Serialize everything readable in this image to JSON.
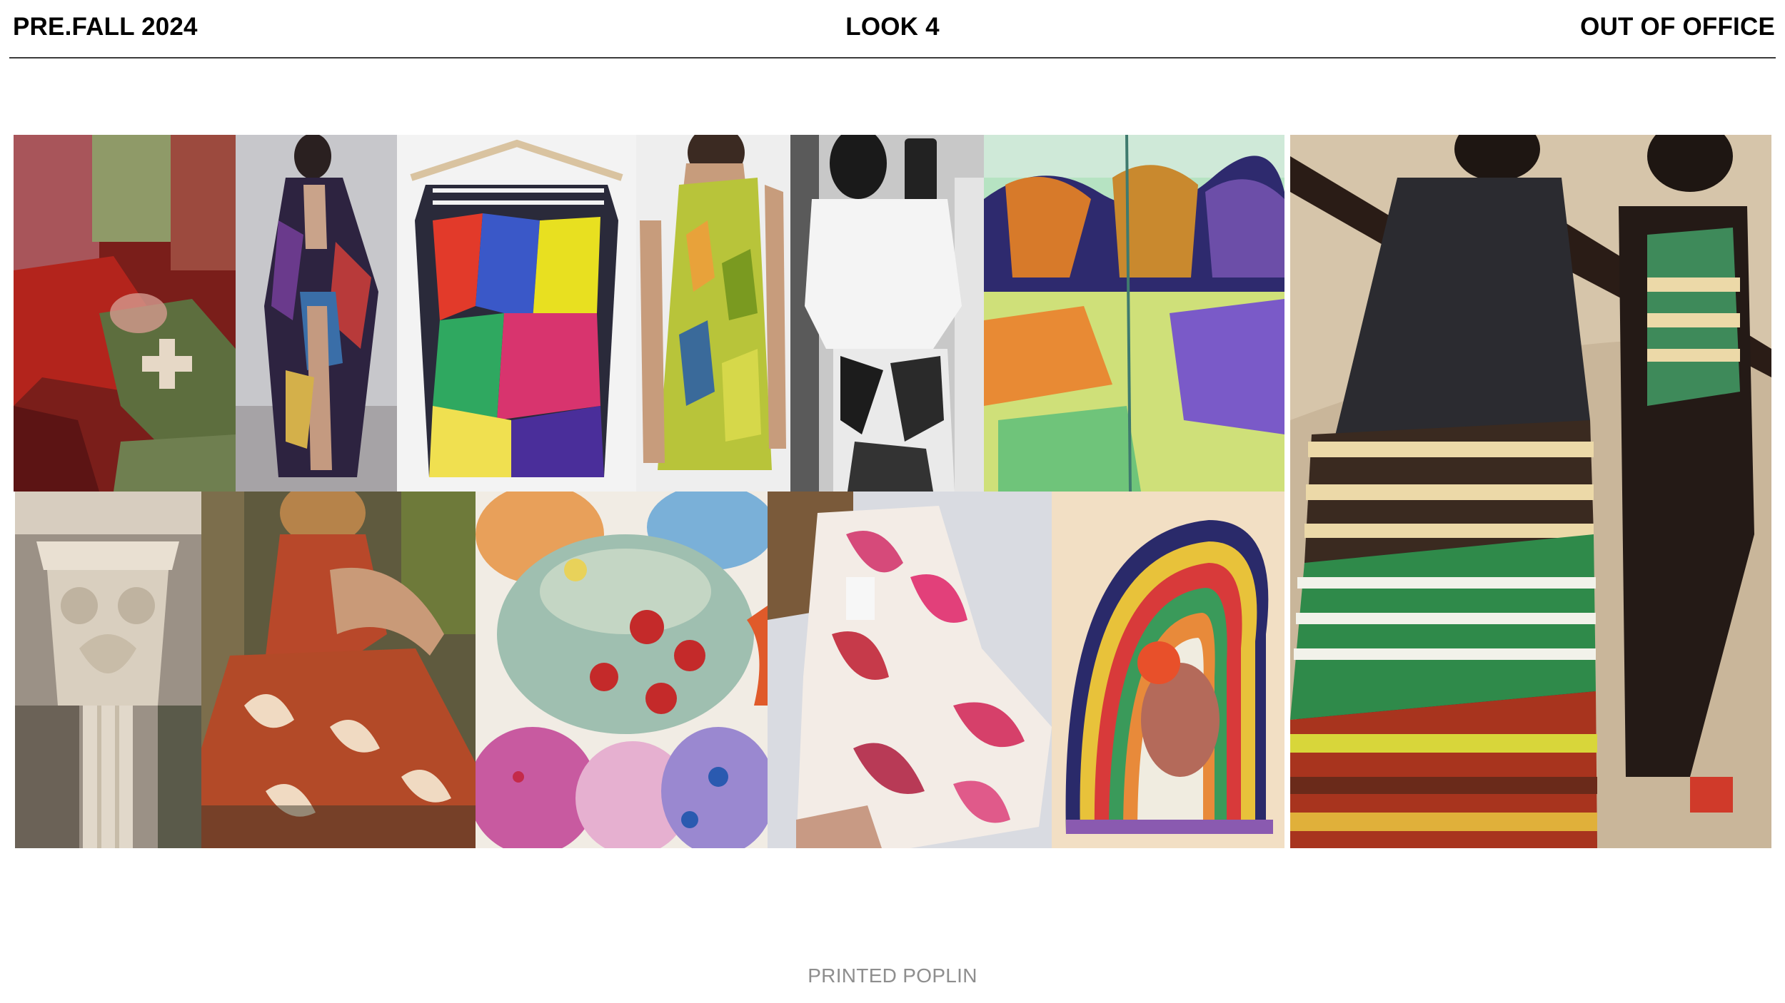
{
  "header": {
    "season": "PRE.FALL 2024",
    "look": "LOOK 4",
    "collection": "OUT OF OFFICE"
  },
  "footer": {
    "fabric": "PRINTED POPLIN"
  },
  "moodboard": {
    "images": [
      {
        "subject": "red-green-tapestry-textile"
      },
      {
        "subject": "model-printed-robe-dress"
      },
      {
        "subject": "printed-top-on-hanger"
      },
      {
        "subject": "model-chartreuse-one-shoulder-dress"
      },
      {
        "subject": "mirror-selfie-monochrome-print-skirt"
      },
      {
        "subject": "landscape-painting-sketchbook"
      },
      {
        "subject": "carved-stone-column-capital"
      },
      {
        "subject": "woman-rust-floral-maxi-dress"
      },
      {
        "subject": "watercolor-floral-painting"
      },
      {
        "subject": "pink-floral-print-coat"
      },
      {
        "subject": "abstract-rainbow-arcs-painting"
      },
      {
        "subject": "models-striped-dresses-beach"
      }
    ]
  },
  "colors": {
    "rule": "#3a3a3a",
    "footer_text": "#8e8e8e"
  }
}
